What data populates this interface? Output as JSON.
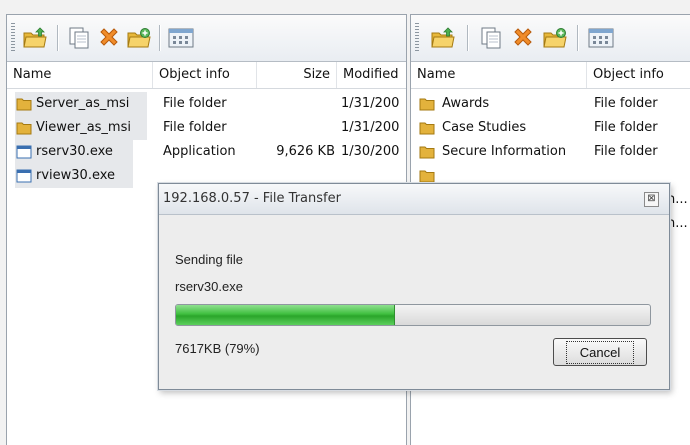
{
  "left_pane": {
    "columns": {
      "name": "Name",
      "object_info": "Object info",
      "size": "Size",
      "modified": "Modified"
    },
    "rows": [
      {
        "name": "Server_as_msi",
        "info": "File folder",
        "size": "",
        "modified": "1/31/200",
        "icon": "folder-icon"
      },
      {
        "name": "Viewer_as_msi",
        "info": "File folder",
        "size": "",
        "modified": "1/31/200",
        "icon": "folder-icon"
      },
      {
        "name": "rserv30.exe",
        "info": "Application",
        "size": "9,626 KB",
        "modified": "1/30/200",
        "icon": "application-icon"
      },
      {
        "name": "rview30.exe",
        "info": "",
        "size": "",
        "modified": "",
        "icon": "application-icon"
      }
    ]
  },
  "right_pane": {
    "columns": {
      "name": "Name",
      "object_info": "Object info"
    },
    "rows": [
      {
        "name": "Awards",
        "info": "File folder",
        "icon": "folder-icon"
      },
      {
        "name": "Case Studies",
        "info": "File folder",
        "icon": "folder-icon"
      },
      {
        "name": "Secure Information",
        "info": "File folder",
        "icon": "folder-icon"
      }
    ],
    "truncated": [
      "n...",
      "n..."
    ]
  },
  "toolbar": {
    "icons": [
      "folder-up-icon",
      "copy-icon",
      "delete-icon",
      "new-folder-icon",
      "view-details-icon"
    ]
  },
  "dialog": {
    "title": "192.168.0.57 - File Transfer",
    "close_glyph": "⊠",
    "status": "Sending file",
    "filename": "rserv30.exe",
    "progress_text": "7617KB (79%)",
    "progress_fraction": 0.46,
    "cancel_label": "Cancel"
  },
  "colors": {
    "progress_green": "#3fbf3f",
    "selection": "#e6e8eb",
    "folder": "#e3b23c"
  }
}
